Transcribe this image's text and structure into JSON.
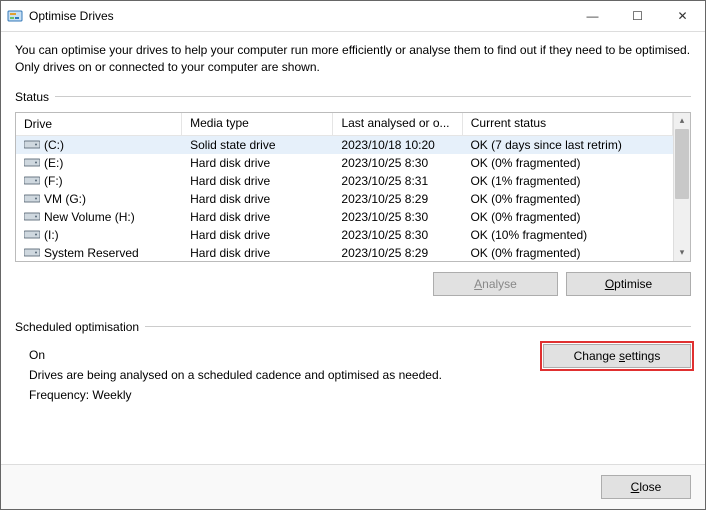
{
  "window": {
    "title": "Optimise Drives",
    "controls": {
      "minimize": "—",
      "maximize": "☐",
      "close": "✕"
    }
  },
  "intro": "You can optimise your drives to help your computer run more efficiently or analyse them to find out if they need to be optimised. Only drives on or connected to your computer are shown.",
  "status_label": "Status",
  "columns": {
    "drive": "Drive",
    "media": "Media type",
    "last": "Last analysed or o...",
    "status": "Current status"
  },
  "drives": [
    {
      "name": "(C:)",
      "media": "Solid state drive",
      "last": "2023/10/18 10:20",
      "status": "OK (7 days since last retrim)",
      "selected": true
    },
    {
      "name": "(E:)",
      "media": "Hard disk drive",
      "last": "2023/10/25 8:30",
      "status": "OK (0% fragmented)"
    },
    {
      "name": "(F:)",
      "media": "Hard disk drive",
      "last": "2023/10/25 8:31",
      "status": "OK (1% fragmented)"
    },
    {
      "name": "VM (G:)",
      "media": "Hard disk drive",
      "last": "2023/10/25 8:29",
      "status": "OK (0% fragmented)"
    },
    {
      "name": "New Volume (H:)",
      "media": "Hard disk drive",
      "last": "2023/10/25 8:30",
      "status": "OK (0% fragmented)"
    },
    {
      "name": "(I:)",
      "media": "Hard disk drive",
      "last": "2023/10/25 8:30",
      "status": "OK (10% fragmented)"
    },
    {
      "name": "System Reserved",
      "media": "Hard disk drive",
      "last": "2023/10/25 8:29",
      "status": "OK (0% fragmented)"
    }
  ],
  "buttons": {
    "analyse_pre": "",
    "analyse_acc": "A",
    "analyse_post": "nalyse",
    "optimise_pre": "",
    "optimise_acc": "O",
    "optimise_post": "ptimise",
    "change_pre": "Change ",
    "change_acc": "s",
    "change_post": "ettings",
    "close_pre": "",
    "close_acc": "C",
    "close_post": "lose"
  },
  "scheduled": {
    "label": "Scheduled optimisation",
    "state": "On",
    "desc": "Drives are being analysed on a scheduled cadence and optimised as needed.",
    "freq": "Frequency: Weekly"
  }
}
